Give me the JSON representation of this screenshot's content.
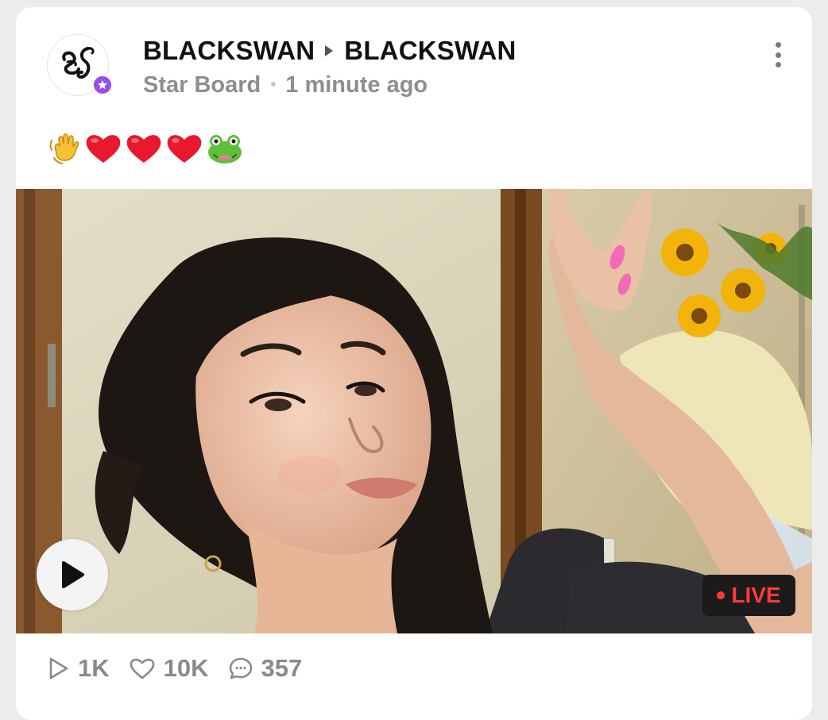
{
  "post": {
    "author": "BLACKSWAN",
    "channel": "BLACKSWAN",
    "board": "Star Board",
    "time": "1 minute ago",
    "content_emojis": [
      "👋",
      "❤️",
      "❤️",
      "❤️",
      "🐸"
    ],
    "live_label": "LIVE",
    "stats": {
      "plays": "1K",
      "likes": "10K",
      "comments": "357"
    }
  },
  "icons": {
    "avatar": "blackswan-logo",
    "badge": "star-badge-icon",
    "more": "more-vertical-icon",
    "play": "play-icon",
    "views": "play-outline-icon",
    "likes": "heart-icon",
    "comments": "comment-icon"
  },
  "colors": {
    "badge": "#9b4de8",
    "live_text": "#ff3a3a",
    "live_bg": "#1b1b1b",
    "muted_text": "#8e8e8e"
  }
}
